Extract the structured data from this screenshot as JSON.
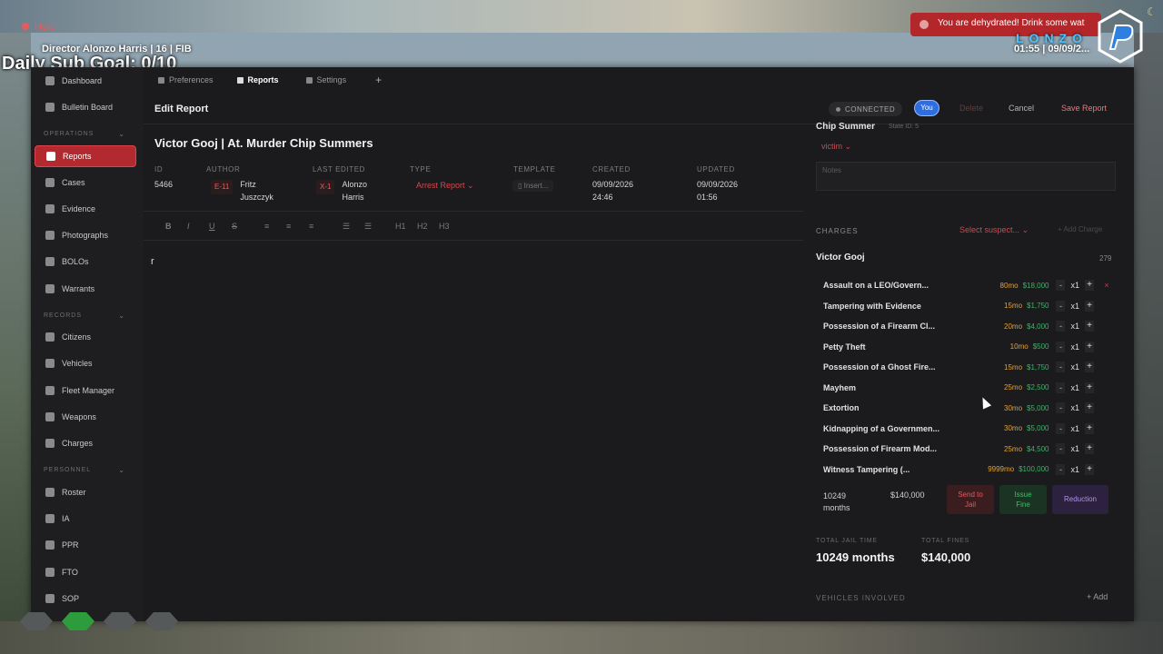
{
  "hud": {
    "help": "Help",
    "player": "Director Alonzo Harris | 16 | FIB",
    "goal": "Daily Sub Goal: 0/10",
    "notification": "You are dehydrated! Drink some wat",
    "brand": "LONZO",
    "clock": "01:55 | 09/09/2..."
  },
  "sidebar": {
    "dashboard": "Dashboard",
    "bulletin": "Bulletin Board",
    "sec_operations": "OPERATIONS",
    "reports": "Reports",
    "cases": "Cases",
    "evidence": "Evidence",
    "photographs": "Photographs",
    "bolos": "BOLOs",
    "warrants": "Warrants",
    "sec_records": "RECORDS",
    "citizens": "Citizens",
    "vehicles": "Vehicles",
    "fleet": "Fleet Manager",
    "weapons": "Weapons",
    "charges": "Charges",
    "sec_personnel": "PERSONNEL",
    "roster": "Roster",
    "ia": "IA",
    "ppr": "PPR",
    "fto": "FTO",
    "sop": "SOP"
  },
  "topnav": {
    "preferences": "Preferences",
    "reports": "Reports",
    "settings": "Settings",
    "plus": "+"
  },
  "toolbar": {
    "title": "Edit Report",
    "connected": "CONNECTED",
    "you": "You",
    "delete": "Delete",
    "cancel": "Cancel",
    "save": "Save Report"
  },
  "report": {
    "title": "Victor Gooj | At. Murder Chip Summers",
    "labels": {
      "id": "ID",
      "author": "AUTHOR",
      "last_edited": "LAST EDITED",
      "type": "TYPE",
      "template": "TEMPLATE",
      "created": "CREATED",
      "updated": "UPDATED"
    },
    "id": "5466",
    "author_badge": "E-11",
    "author_name_1": "Fritz",
    "author_name_2": "Juszczyk",
    "editor_badge": "X-1",
    "editor_name_1": "Alonzo",
    "editor_name_2": "Harris",
    "type": "Arrest Report",
    "template": "Insert...",
    "created_date": "09/09/2026",
    "created_time": "24:46",
    "updated_date": "09/09/2026",
    "updated_time": "01:56",
    "body": "r"
  },
  "format_bar": {
    "bold": "B",
    "italic": "I",
    "underline": "U",
    "strike": "S",
    "h1": "H1",
    "h2": "H2",
    "h3": "H3"
  },
  "panel": {
    "suspect": "Chip Summer",
    "state_id": "State ID: 5",
    "role": "victim",
    "notes_placeholder": "Notes",
    "charges_header": "CHARGES",
    "select_suspect": "Select suspect...",
    "add_charge": "+ Add Charge",
    "charge_suspect": "Victor Gooj",
    "charge_total_id": "279",
    "charges": [
      {
        "name": "Assault on a LEO/Govern...",
        "time": "80mo",
        "fine": "$18,000",
        "qty": "x1"
      },
      {
        "name": "Tampering with Evidence",
        "time": "15mo",
        "fine": "$1,750",
        "qty": "x1"
      },
      {
        "name": "Possession of a Firearm Cl...",
        "time": "20mo",
        "fine": "$4,000",
        "qty": "x1"
      },
      {
        "name": "Petty Theft",
        "time": "10mo",
        "fine": "$500",
        "qty": "x1"
      },
      {
        "name": "Possession of a Ghost Fire...",
        "time": "15mo",
        "fine": "$1,750",
        "qty": "x1"
      },
      {
        "name": "Mayhem",
        "time": "25mo",
        "fine": "$2,500",
        "qty": "x1"
      },
      {
        "name": "Extortion",
        "time": "30mo",
        "fine": "$5,000",
        "qty": "x1"
      },
      {
        "name": "Kidnapping of a Governmen...",
        "time": "30mo",
        "fine": "$5,000",
        "qty": "x1"
      },
      {
        "name": "Possession of Firearm Mod...",
        "time": "25mo",
        "fine": "$4,500",
        "qty": "x1"
      },
      {
        "name": "Witness Tampering (...",
        "time": "9999mo",
        "fine": "$100,000",
        "qty": "x1"
      }
    ],
    "sum_months_1": "10249",
    "sum_months_2": "months",
    "sum_fine": "$140,000",
    "send_to_jail_1": "Send to",
    "send_to_jail_2": "Jail",
    "issue_fine_1": "Issue",
    "issue_fine_2": "Fine",
    "reduction": "Reduction",
    "total_jail_label": "TOTAL JAIL TIME",
    "total_fines_label": "TOTAL FINES",
    "total_jail": "10249 months",
    "total_fines": "$140,000",
    "vehicles_header": "VEHICLES INVOLVED",
    "vehicles_add": "+ Add"
  }
}
